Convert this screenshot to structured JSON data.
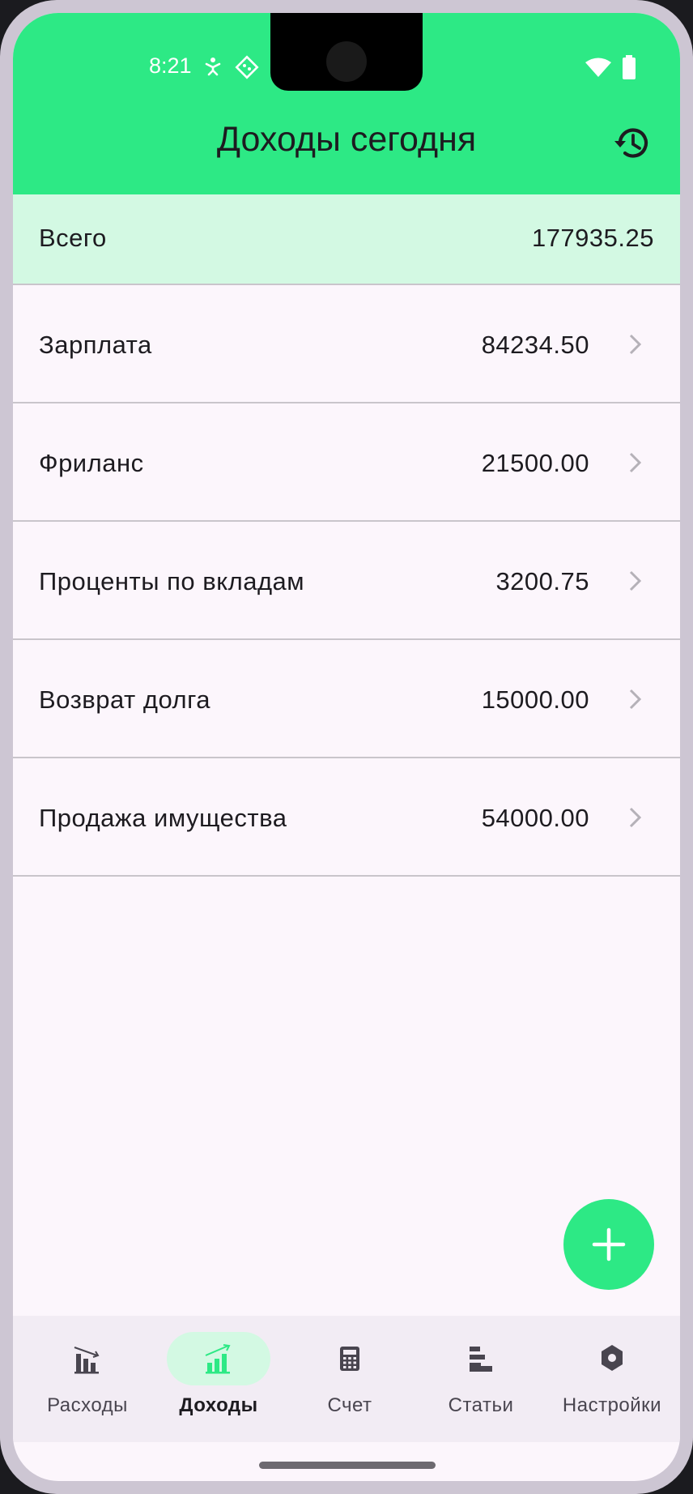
{
  "status": {
    "time": "8:21"
  },
  "header": {
    "title": "Доходы сегодня"
  },
  "total": {
    "label": "Всего",
    "amount": "177935.25"
  },
  "items": [
    {
      "label": "Зарплата",
      "amount": "84234.50"
    },
    {
      "label": "Фриланс",
      "amount": "21500.00"
    },
    {
      "label": "Проценты по вкладам",
      "amount": "3200.75"
    },
    {
      "label": "Возврат долга",
      "amount": "15000.00"
    },
    {
      "label": "Продажа имущества",
      "amount": "54000.00"
    }
  ],
  "nav": [
    {
      "label": "Расходы",
      "icon": "expenses-chart-icon",
      "active": false
    },
    {
      "label": "Доходы",
      "icon": "income-chart-icon",
      "active": true
    },
    {
      "label": "Счет",
      "icon": "calculator-icon",
      "active": false
    },
    {
      "label": "Статьи",
      "icon": "categories-icon",
      "active": false
    },
    {
      "label": "Настройки",
      "icon": "settings-icon",
      "active": false
    }
  ],
  "colors": {
    "accent": "#2de985",
    "accent_light": "#d3f9e3",
    "background": "#fcf6fc",
    "navbar": "#f2ecf4",
    "text": "#1d1b20"
  }
}
